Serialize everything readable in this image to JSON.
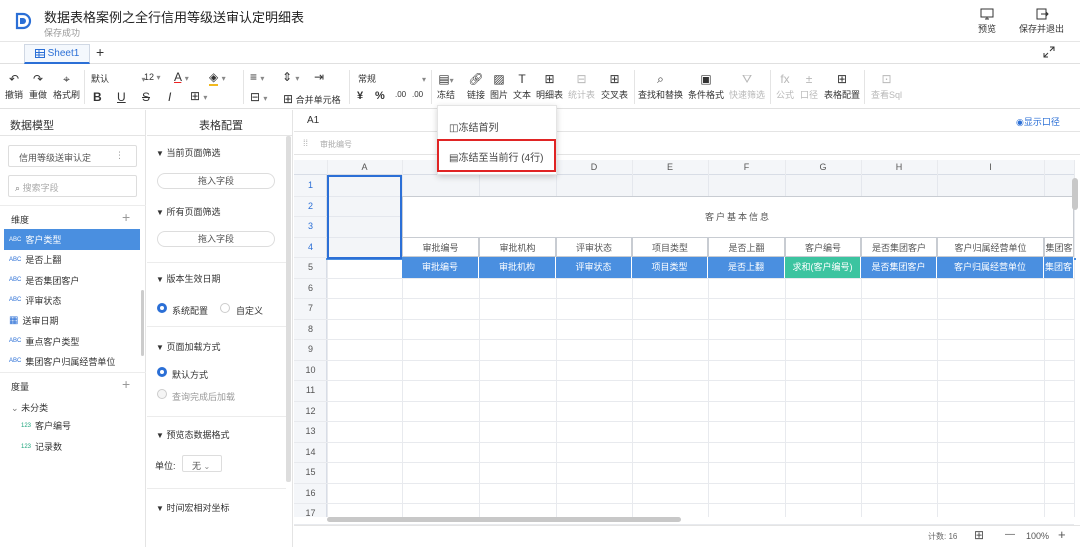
{
  "header": {
    "title": "数据表格案例之全行信用等级送审认定明细表",
    "subtitle": "保存成功",
    "preview_label": "预览",
    "save_exit_label": "保存并退出"
  },
  "sheet": {
    "tab_label": "Sheet1",
    "add_label": "+"
  },
  "toolbar": {
    "undo": "撤销",
    "redo": "重做",
    "format_brush": "格式刷",
    "font_name": "默认",
    "font_size": "12",
    "bold": "B",
    "underline": "U",
    "strike": "S",
    "italic": "I",
    "merge": "合并单元格",
    "number_format": "常规",
    "currency": "¥",
    "percent": "%",
    "dec_inc": ".00",
    "dec_dec": ".00",
    "freeze": "冻结",
    "link": "链接",
    "image": "图片",
    "text": "文本",
    "detail": "明细表",
    "stat": "统计表",
    "cross": "交叉表",
    "find_replace": "查找和替换",
    "cond_format": "条件格式",
    "quick_filter": "快速筛选",
    "formula": "公式",
    "caliber": "口径",
    "table_config": "表格配置",
    "view_sql": "查看Sql"
  },
  "freeze_menu": {
    "item1": "冻结首列",
    "item2": "冻结至当前行 (4行)"
  },
  "left_panel": {
    "title": "数据模型",
    "dataset": "信用等级送审认定",
    "search_placeholder": "搜索字段",
    "dimension_label": "维度",
    "measure_label": "度量",
    "uncategorized": "未分类",
    "dimensions": [
      "客户类型",
      "是否上翻",
      "是否集团客户",
      "评审状态",
      "送审日期",
      "重点客户类型",
      "集团客户归属经营单位"
    ],
    "measures": [
      "客户编号",
      "记录数"
    ],
    "abc": "ABC",
    "num": "123"
  },
  "mid_panel": {
    "title": "表格配置",
    "filter_current": "当前页面筛选",
    "drag_field": "拖入字段",
    "filter_all": "所有页面筛选",
    "version_date": "版本生效日期",
    "sys_config": "系统配置",
    "custom": "自定义",
    "load_mode": "页面加载方式",
    "default_mode": "默认方式",
    "load_after_query": "查询完成后加载",
    "preview_format": "预览态数据格式",
    "unit_label": "单位:",
    "unit_value": "无",
    "time_axis": "时间宏相对坐标"
  },
  "grid": {
    "cell_ref": "A1",
    "formula_placeholder": "审批编号",
    "show_caliber": "显示口径",
    "columns": [
      "A",
      "B",
      "C",
      "D",
      "E",
      "F",
      "G",
      "H",
      "I"
    ],
    "rows": [
      "1",
      "2",
      "3",
      "4",
      "5",
      "6",
      "7",
      "8",
      "9",
      "10",
      "11",
      "12",
      "13",
      "14",
      "15",
      "16",
      "17"
    ],
    "merged_header": "客户基本信息",
    "row4": [
      "审批编号",
      "审批机构",
      "评审状态",
      "项目类型",
      "是否上翻",
      "客户编号",
      "是否集团客户",
      "客户归属经营单位",
      "集团客"
    ],
    "row5": [
      "审批编号",
      "审批机构",
      "评审状态",
      "项目类型",
      "是否上翻",
      "求和(客户编号)",
      "是否集团客户",
      "客户归属经营单位",
      "集团客"
    ]
  },
  "status": {
    "count": "计数: 16",
    "zoom": "100%",
    "minus": "—",
    "plus": "+"
  }
}
